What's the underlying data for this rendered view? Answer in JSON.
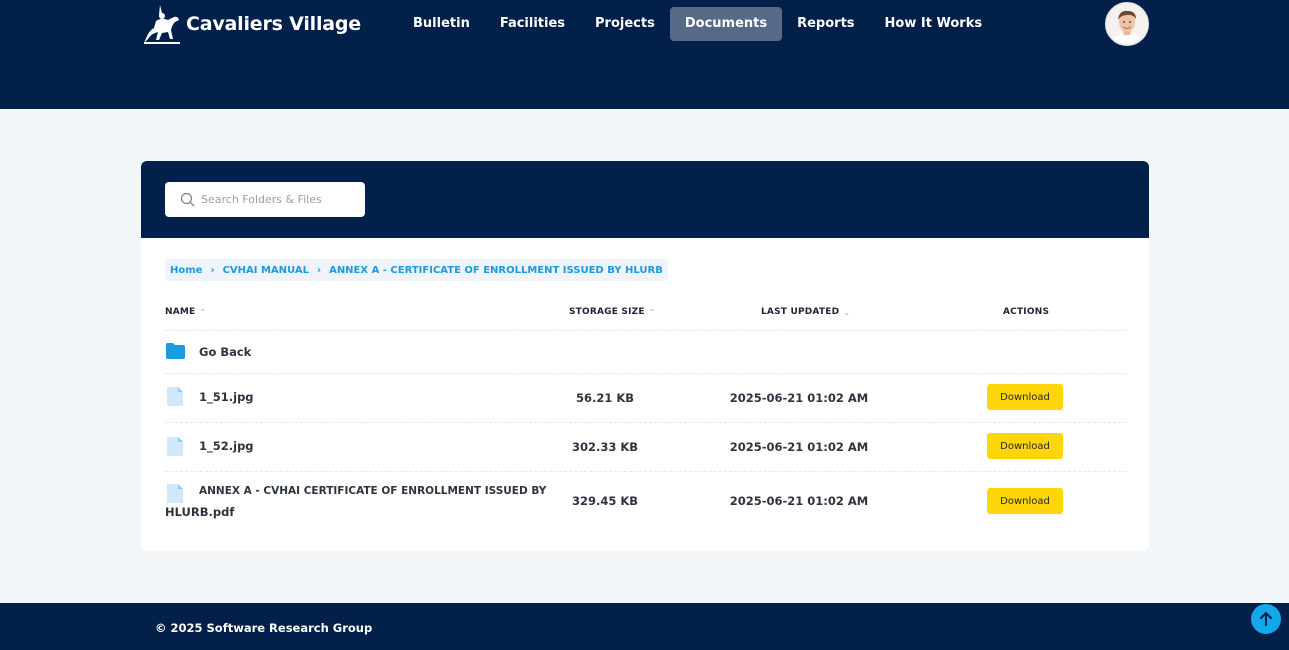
{
  "brand": {
    "name": "Cavaliers Village",
    "logo": "horse-rider-logo"
  },
  "nav": {
    "items": [
      {
        "label": "Bulletin"
      },
      {
        "label": "Facilities"
      },
      {
        "label": "Projects"
      },
      {
        "label": "Documents",
        "active": true
      },
      {
        "label": "Reports"
      },
      {
        "label": "How It Works"
      }
    ]
  },
  "search": {
    "placeholder": "Search Folders & Files",
    "value": ""
  },
  "breadcrumb": [
    {
      "label": "Home"
    },
    {
      "label": "CVHAI MANUAL"
    },
    {
      "label": "ANNEX A - CERTIFICATE OF ENROLLMENT ISSUED BY HLURB"
    }
  ],
  "table": {
    "headers": {
      "name": "NAME",
      "size": "STORAGE SIZE",
      "updated": "LAST UPDATED",
      "actions": "ACTIONS"
    },
    "go_back": "Go Back",
    "rows": [
      {
        "name": "1_51.jpg",
        "size": "56.21 KB",
        "updated": "2025-06-21 01:02 AM",
        "action": "Download"
      },
      {
        "name": "1_52.jpg",
        "size": "302.33 KB",
        "updated": "2025-06-21 01:02 AM",
        "action": "Download"
      },
      {
        "name_line1": "ANNEX A - CVHAI CERTIFICATE OF ENROLLMENT ISSUED BY",
        "name_line2": "HLURB.pdf",
        "size": "329.45 KB",
        "updated": "2025-06-21 01:02 AM",
        "action": "Download"
      }
    ]
  },
  "footer": {
    "copyright": "© 2025 Software Research Group"
  },
  "colors": {
    "primary": "#03204a",
    "accent": "#1a9be0",
    "download": "#ffd60a",
    "active_nav": "#566a87"
  }
}
